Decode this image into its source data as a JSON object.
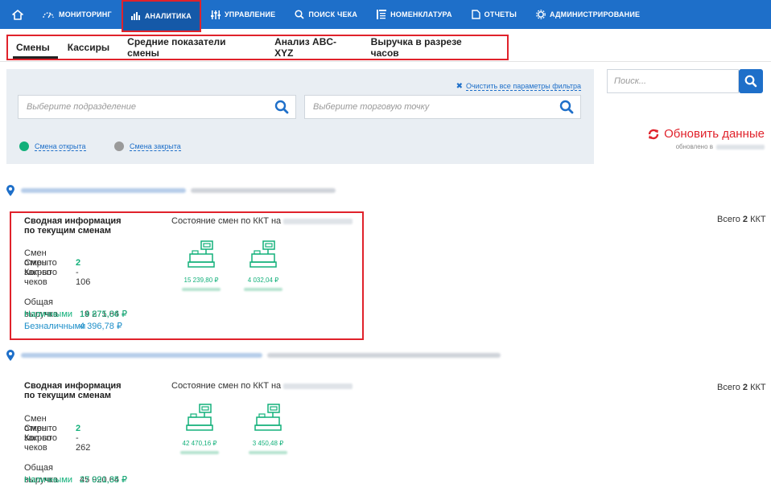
{
  "nav": {
    "items": [
      {
        "label": "МОНИТОРИНГ",
        "icon": "monitoring-icon"
      },
      {
        "label": "АНАЛИТИКА",
        "icon": "analytics-icon",
        "active": true
      },
      {
        "label": "УПРАВЛЕНИЕ",
        "icon": "management-icon"
      },
      {
        "label": "ПОИСК ЧЕКА",
        "icon": "search-icon"
      },
      {
        "label": "НОМЕНКЛАТУРА",
        "icon": "nomenclature-icon"
      },
      {
        "label": "ОТЧЕТЫ",
        "icon": "reports-icon"
      },
      {
        "label": "АДМИНИСТРИРОВАНИЕ",
        "icon": "gear-icon"
      }
    ]
  },
  "tabs": [
    {
      "label": "Смены",
      "active": true
    },
    {
      "label": "Кассиры"
    },
    {
      "label": "Средние показатели смены"
    },
    {
      "label": "Анализ ABC-XYZ"
    },
    {
      "label": "Выручка в разрезе часов"
    }
  ],
  "filters": {
    "clear_label": "Очистить все параметры фильтра",
    "division_placeholder": "Выберите подразделение",
    "point_placeholder": "Выберите торговую точку",
    "legend_open": "Смена открыта",
    "legend_closed": "Смена закрыта"
  },
  "search": {
    "placeholder": "Поиск..."
  },
  "refresh": {
    "label": "Обновить данные",
    "updated_prefix": "обновлено в"
  },
  "colors": {
    "accent": "#1e6fc9",
    "open": "#12b07a",
    "closed": "#9a9a9a",
    "highlight": "#e0222b"
  },
  "blocks": [
    {
      "title_line1": "Сводная информация",
      "title_line2": "по текущим сменам",
      "state_label": "Состояние смен по ККТ на",
      "total_prefix": "Всего",
      "total_count": "2",
      "total_suffix": "ККТ",
      "open_label": "Смен открыто",
      "open_value": "2",
      "closed_label": "Смен закрыто",
      "closed_value": "-",
      "checks_label": "Кол-во чеков",
      "checks_value": "106",
      "revenue_label": "Общая выручка",
      "revenue_value": "19 271,84 ₽",
      "cash_label": "Наличными",
      "cash_value": "14 875,06 ₽",
      "card_label": "Безналичными",
      "card_value": "4 396,78 ₽",
      "kkt": [
        {
          "amount": "15 239,80 ₽"
        },
        {
          "amount": "4 032,04 ₽"
        }
      ]
    },
    {
      "title_line1": "Сводная информация",
      "title_line2": "по текущим сменам",
      "state_label": "Состояние смен по ККТ на",
      "total_prefix": "Всего",
      "total_count": "2",
      "total_suffix": "ККТ",
      "open_label": "Смен открыто",
      "open_value": "2",
      "closed_label": "Смен закрыто",
      "closed_value": "-",
      "checks_label": "Кол-во чеков",
      "checks_value": "262",
      "revenue_label": "Общая выручка",
      "revenue_value": "45 920,64 ₽",
      "cash_label": "Наличными",
      "cash_value": "27 091,35 ₽",
      "kkt": [
        {
          "amount": "42 470,16 ₽"
        },
        {
          "amount": "3 450,48 ₽"
        }
      ]
    }
  ]
}
